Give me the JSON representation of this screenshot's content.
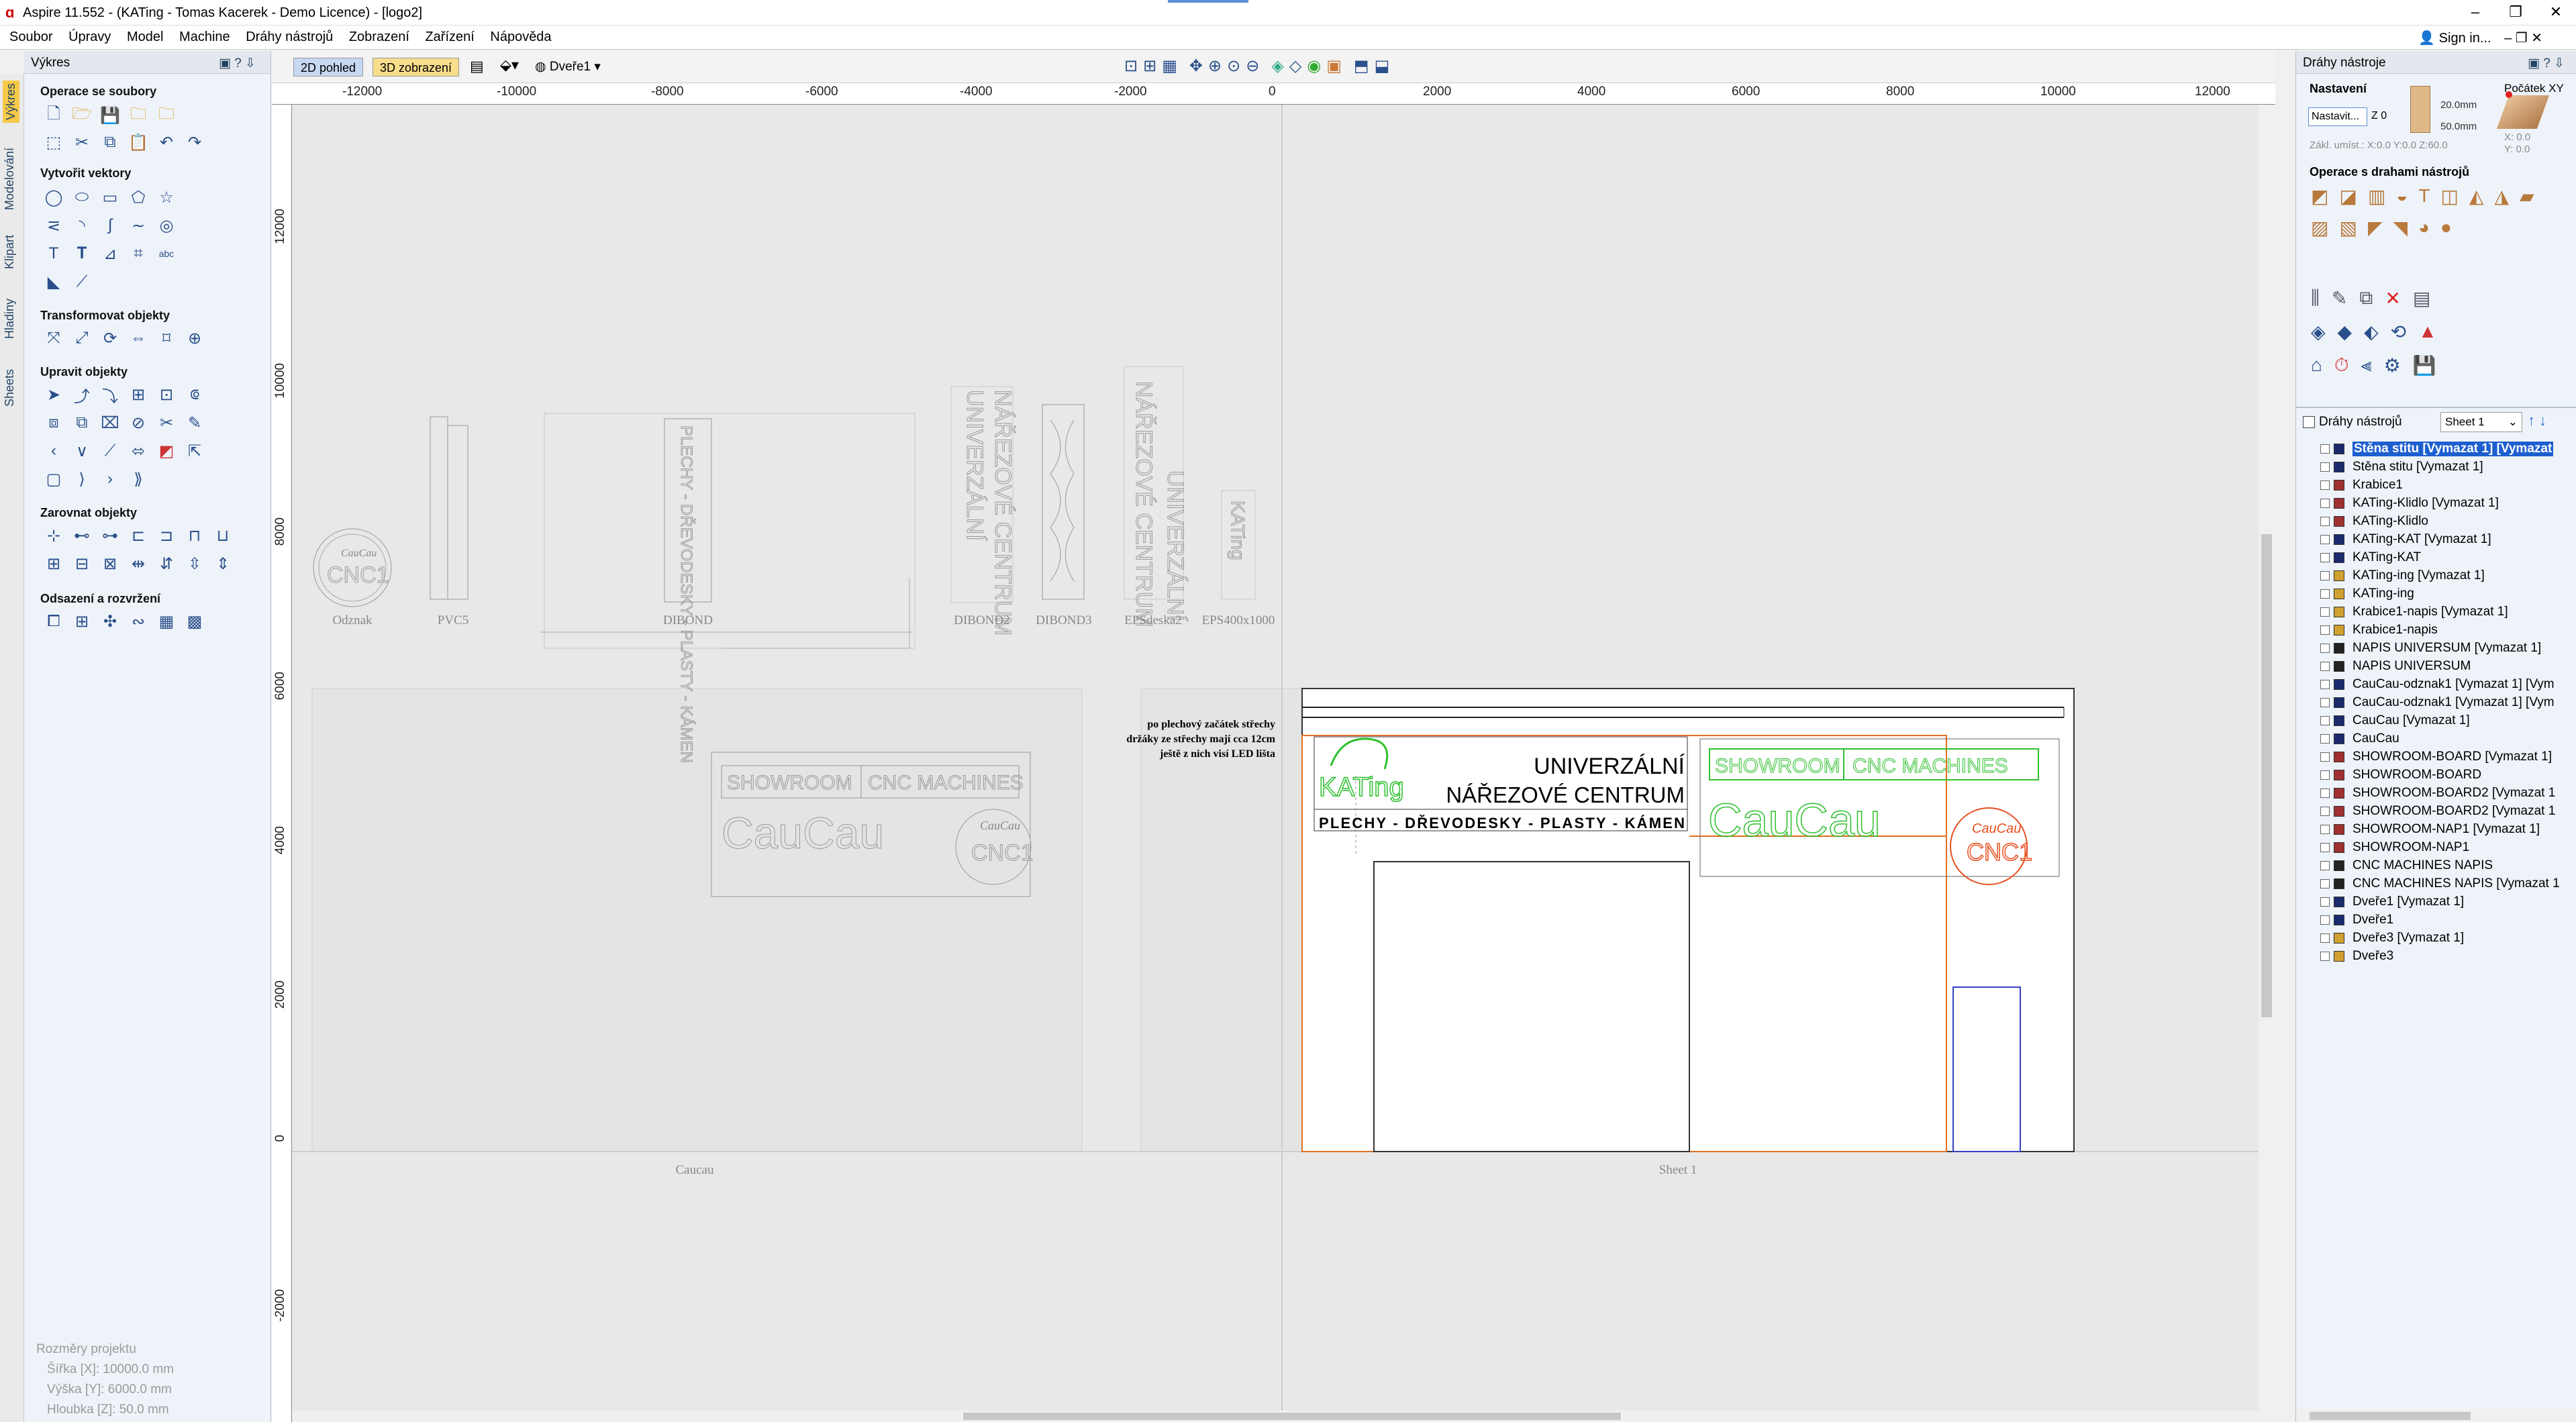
{
  "window": {
    "title": "Aspire 11.552 - (KATing - Tomas Kacerek - Demo Licence) - [logo2]",
    "controls": [
      "–",
      "❐",
      "✕"
    ]
  },
  "menubar": {
    "items": [
      "Soubor",
      "Úpravy",
      "Model",
      "Machine",
      "Dráhy nástrojů",
      "Zobrazení",
      "Zařízení",
      "Nápověda"
    ],
    "sign_in": "Sign in..."
  },
  "left_tabs": [
    "Výkres",
    "Modelování",
    "Klipart",
    "Hladiny",
    "Sheets"
  ],
  "left_panel": {
    "header": "Výkres",
    "sections": {
      "file_ops": "Operace se soubory",
      "create_vectors": "Vytvořit vektory",
      "transform": "Transformovat objekty",
      "edit": "Upravit objekty",
      "align": "Zarovnat objekty",
      "offset": "Odsazení a rozvržení"
    },
    "project_info": {
      "title": "Rozměry projektu",
      "width": "Šířka  [X]: 10000.0 mm",
      "height": "Výška  [Y]: 6000.0 mm",
      "depth": "Hloubka [Z]: 50.0 mm"
    }
  },
  "toolbar": {
    "view2d": "2D pohled",
    "view3d": "3D zobrazení",
    "layer": "Dveře1"
  },
  "ruler": {
    "top": [
      "-12000",
      "-10000",
      "-8000",
      "-6000",
      "-4000",
      "-2000",
      "0",
      "2000",
      "4000",
      "6000",
      "8000",
      "10000",
      "12000"
    ],
    "left": [
      "12000",
      "10000",
      "8000",
      "6000",
      "4000",
      "2000",
      "0",
      "-2000"
    ]
  },
  "canvas": {
    "sheet_labels": [
      "Caucau",
      "Sheet 1"
    ],
    "part_labels": [
      "Odznak",
      "PVC5",
      "DIBOND",
      "DIBOND2",
      "DIBOND3",
      "EPSdeska2",
      "EPS400x1000"
    ],
    "note_lines": [
      "po plechový začátek střechy",
      "držáky ze střechy mají cca 12cm",
      "ještě z nich visí LED lišta"
    ],
    "sign": {
      "line1": "UNIVERZÁLNÍ",
      "line2": "NÁŘEZOVÉ CENTRUM",
      "line3": "PLECHY - DŘEVODESKY - PLASTY - KÁMEN",
      "brand": "KATing",
      "showroom": "SHOWROOM",
      "cnc": "CNC MACHINES",
      "caucau": "CauCau",
      "cnc1": "CNC1",
      "vertical1": "UNIVERZÁLNÍ",
      "vertical2": "NÁŘEZOVÉ CENTRUM",
      "vertical3": "PLECHY - DŘEVODESKY - PLASTY - KÁMEN"
    }
  },
  "right_panel": {
    "header": "Dráhy nástroje",
    "setup_title": "Nastavení",
    "origin_title": "Počátek XY",
    "setup_button": "Nastavit...",
    "z_label": "Z 0",
    "depth1": "20.0mm",
    "depth2": "50.0mm",
    "origin_info": "Zákl. umíst.: X:0.0 Y:0.0 Z:60.0",
    "origin_x": "X: 0.0",
    "origin_y": "Y: 0.0",
    "ops_title": "Operace s drahami nástrojů",
    "list_title": "Dráhy nástrojů",
    "sheet_select": "Sheet 1",
    "toolpaths": [
      {
        "name": "Stěna stitu [Vymazat 1] [Vymazat",
        "color": "#1a2a6c",
        "selected": true
      },
      {
        "name": "Stěna stitu [Vymazat 1]",
        "color": "#1a2a6c"
      },
      {
        "name": "Krabice1",
        "color": "#a03030"
      },
      {
        "name": "KATing-Klidlo [Vymazat 1]",
        "color": "#a03030"
      },
      {
        "name": "KATing-Klidlo",
        "color": "#a03030"
      },
      {
        "name": "KATing-KAT [Vymazat 1]",
        "color": "#1a2a6c"
      },
      {
        "name": "KATing-KAT",
        "color": "#1a2a6c"
      },
      {
        "name": "KATing-ing [Vymazat 1]",
        "color": "#d0a030"
      },
      {
        "name": "KATing-ing",
        "color": "#d0a030"
      },
      {
        "name": "Krabice1-napis [Vymazat 1]",
        "color": "#d0a030"
      },
      {
        "name": "Krabice1-napis",
        "color": "#d0a030"
      },
      {
        "name": "NAPIS UNIVERSUM [Vymazat 1]",
        "color": "#222"
      },
      {
        "name": "NAPIS UNIVERSUM",
        "color": "#222"
      },
      {
        "name": "CauCau-odznak1 [Vymazat 1] [Vym",
        "color": "#1a2a6c"
      },
      {
        "name": "CauCau-odznak1 [Vymazat 1] [Vym",
        "color": "#1a2a6c"
      },
      {
        "name": "CauCau [Vymazat 1]",
        "color": "#1a2a6c"
      },
      {
        "name": "CauCau",
        "color": "#1a2a6c"
      },
      {
        "name": "SHOWROOM-BOARD [Vymazat 1]",
        "color": "#a03030"
      },
      {
        "name": "SHOWROOM-BOARD",
        "color": "#a03030"
      },
      {
        "name": "SHOWROOM-BOARD2 [Vymazat 1",
        "color": "#a03030"
      },
      {
        "name": "SHOWROOM-BOARD2 [Vymazat 1",
        "color": "#a03030"
      },
      {
        "name": "SHOWROOM-NAP1 [Vymazat 1]",
        "color": "#a03030"
      },
      {
        "name": "SHOWROOM-NAP1",
        "color": "#a03030"
      },
      {
        "name": "CNC MACHINES NAPIS",
        "color": "#222"
      },
      {
        "name": "CNC MACHINES NAPIS [Vymazat 1",
        "color": "#222"
      },
      {
        "name": "Dveře1 [Vymazat 1]",
        "color": "#1a2a6c"
      },
      {
        "name": "Dveře1",
        "color": "#1a2a6c"
      },
      {
        "name": "Dveře3 [Vymazat 1]",
        "color": "#d0a030"
      },
      {
        "name": "Dveře3",
        "color": "#d0a030"
      }
    ]
  }
}
